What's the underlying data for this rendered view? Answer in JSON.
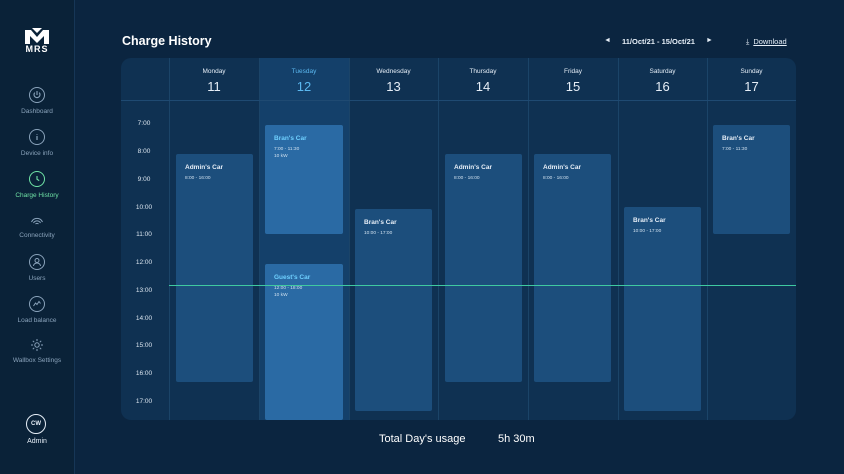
{
  "brand": {
    "logo_text": "MRS"
  },
  "sidebar": {
    "items": [
      {
        "label": "Dashboard",
        "icon": "power-icon"
      },
      {
        "label": "Device info",
        "icon": "info-icon"
      },
      {
        "label": "Charge History",
        "icon": "clock-icon",
        "active": true
      },
      {
        "label": "Connectivity",
        "icon": "wifi-icon"
      },
      {
        "label": "Users",
        "icon": "user-icon"
      },
      {
        "label": "Load balance",
        "icon": "balance-icon"
      },
      {
        "label": "Wallbox Settings",
        "icon": "gear-icon"
      }
    ],
    "user": {
      "initials": "CW",
      "role": "Admin"
    }
  },
  "header": {
    "title": "Charge History",
    "prev_icon": "◄",
    "next_icon": "►",
    "date_range": "11/Oct/21 - 15/Oct/21",
    "download_icon": "⤓",
    "download_label": "Download"
  },
  "calendar": {
    "days": [
      {
        "name": "Monday",
        "date": "11"
      },
      {
        "name": "Tuesday",
        "date": "12",
        "active": true
      },
      {
        "name": "Wednesday",
        "date": "13"
      },
      {
        "name": "Thursday",
        "date": "14"
      },
      {
        "name": "Friday",
        "date": "15"
      },
      {
        "name": "Saturday",
        "date": "16"
      },
      {
        "name": "Sunday",
        "date": "17"
      }
    ],
    "hours": [
      "7:00",
      "8:00",
      "9:00",
      "10:00",
      "11:00",
      "12:00",
      "13:00",
      "14:00",
      "15:00",
      "16:00",
      "17:00"
    ],
    "events": [
      {
        "title": "Admin's Car",
        "time": "8:00 - 16:00"
      },
      {
        "title": "Bran's Car",
        "time": "7:00 - 11:30",
        "power": "10 kW"
      },
      {
        "title": "Guest's Car",
        "time": "12:00 - 18:00",
        "power": "10 kW"
      },
      {
        "title": "Bran's Car",
        "time": "10:00 - 17:00"
      },
      {
        "title": "Admin's Car",
        "time": "8:00 - 16:00"
      },
      {
        "title": "Admin's Car",
        "time": "8:00 - 16:00"
      },
      {
        "title": "Bran's Car",
        "time": "10:00 - 17:00"
      },
      {
        "title": "Bran's Car",
        "time": "7:00 - 11:30"
      }
    ]
  },
  "footer": {
    "usage_label": "Total Day's usage",
    "usage_value": "5h 30m"
  },
  "colors": {
    "background": "#0b2540",
    "card": "#0f3152",
    "accent_active": "#6fe3a6",
    "accent_day": "#5bb8f0",
    "event": "#1c4e7c",
    "event_highlight": "#2a6aa4",
    "now_line": "#3fc9a0"
  }
}
